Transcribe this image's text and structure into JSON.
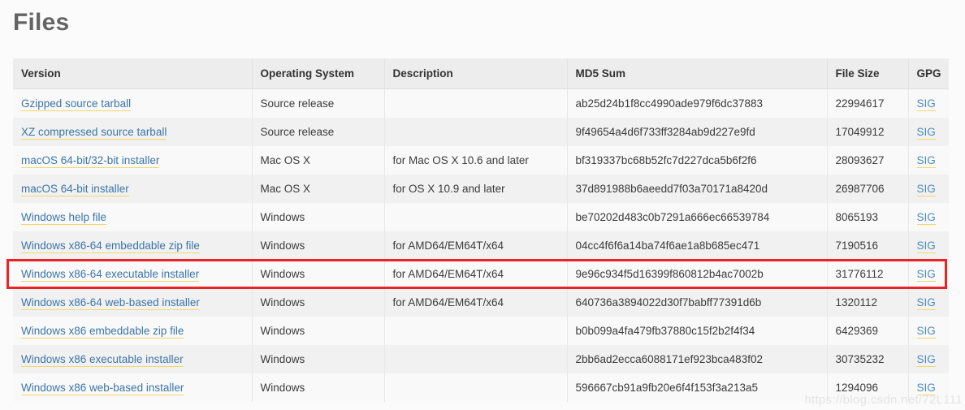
{
  "page": {
    "title": "Files",
    "watermark": "https://blog.csdn.net/72L111"
  },
  "table": {
    "columns": [
      "Version",
      "Operating System",
      "Description",
      "MD5 Sum",
      "File Size",
      "GPG"
    ],
    "gpg_link_label": "SIG",
    "rows": [
      {
        "version": "Gzipped source tarball",
        "os": "Source release",
        "description": "",
        "md5": "ab25d24b1f8cc4990ade979f6dc37883",
        "size": "22994617",
        "gpg": "SIG",
        "highlighted": false
      },
      {
        "version": "XZ compressed source tarball",
        "os": "Source release",
        "description": "",
        "md5": "9f49654a4d6f733ff3284ab9d227e9fd",
        "size": "17049912",
        "gpg": "SIG",
        "highlighted": false
      },
      {
        "version": "macOS 64-bit/32-bit installer",
        "os": "Mac OS X",
        "description": "for Mac OS X 10.6 and later",
        "md5": "bf319337bc68b52fc7d227dca5b6f2f6",
        "size": "28093627",
        "gpg": "SIG",
        "highlighted": false
      },
      {
        "version": "macOS 64-bit installer",
        "os": "Mac OS X",
        "description": "for OS X 10.9 and later",
        "md5": "37d891988b6aeedd7f03a70171a8420d",
        "size": "26987706",
        "gpg": "SIG",
        "highlighted": false
      },
      {
        "version": "Windows help file",
        "os": "Windows",
        "description": "",
        "md5": "be70202d483c0b7291a666ec66539784",
        "size": "8065193",
        "gpg": "SIG",
        "highlighted": false
      },
      {
        "version": "Windows x86-64 embeddable zip file",
        "os": "Windows",
        "description": "for AMD64/EM64T/x64",
        "md5": "04cc4f6f6a14ba74f6ae1a8b685ec471",
        "size": "7190516",
        "gpg": "SIG",
        "highlighted": false
      },
      {
        "version": "Windows x86-64 executable installer",
        "os": "Windows",
        "description": "for AMD64/EM64T/x64",
        "md5": "9e96c934f5d16399f860812b4ac7002b",
        "size": "31776112",
        "gpg": "SIG",
        "highlighted": true
      },
      {
        "version": "Windows x86-64 web-based installer",
        "os": "Windows",
        "description": "for AMD64/EM64T/x64",
        "md5": "640736a3894022d30f7babff77391d6b",
        "size": "1320112",
        "gpg": "SIG",
        "highlighted": false
      },
      {
        "version": "Windows x86 embeddable zip file",
        "os": "Windows",
        "description": "",
        "md5": "b0b099a4fa479fb37880c15f2b2f4f34",
        "size": "6429369",
        "gpg": "SIG",
        "highlighted": false
      },
      {
        "version": "Windows x86 executable installer",
        "os": "Windows",
        "description": "",
        "md5": "2bb6ad2ecca6088171ef923bca483f02",
        "size": "30735232",
        "gpg": "SIG",
        "highlighted": false
      },
      {
        "version": "Windows x86 web-based installer",
        "os": "Windows",
        "description": "",
        "md5": "596667cb91a9fb20e6f4f153f3a213a5",
        "size": "1294096",
        "gpg": "SIG",
        "highlighted": false
      }
    ]
  },
  "colors": {
    "link": "#3c75a8",
    "link_underline": "#f4d66b",
    "sig_link": "#4b8bbe",
    "header_bg": "#ededed",
    "row_odd": "#f9f9f9",
    "row_even": "#f1f1f1",
    "highlight_border": "#ee2222",
    "title": "#646464"
  }
}
